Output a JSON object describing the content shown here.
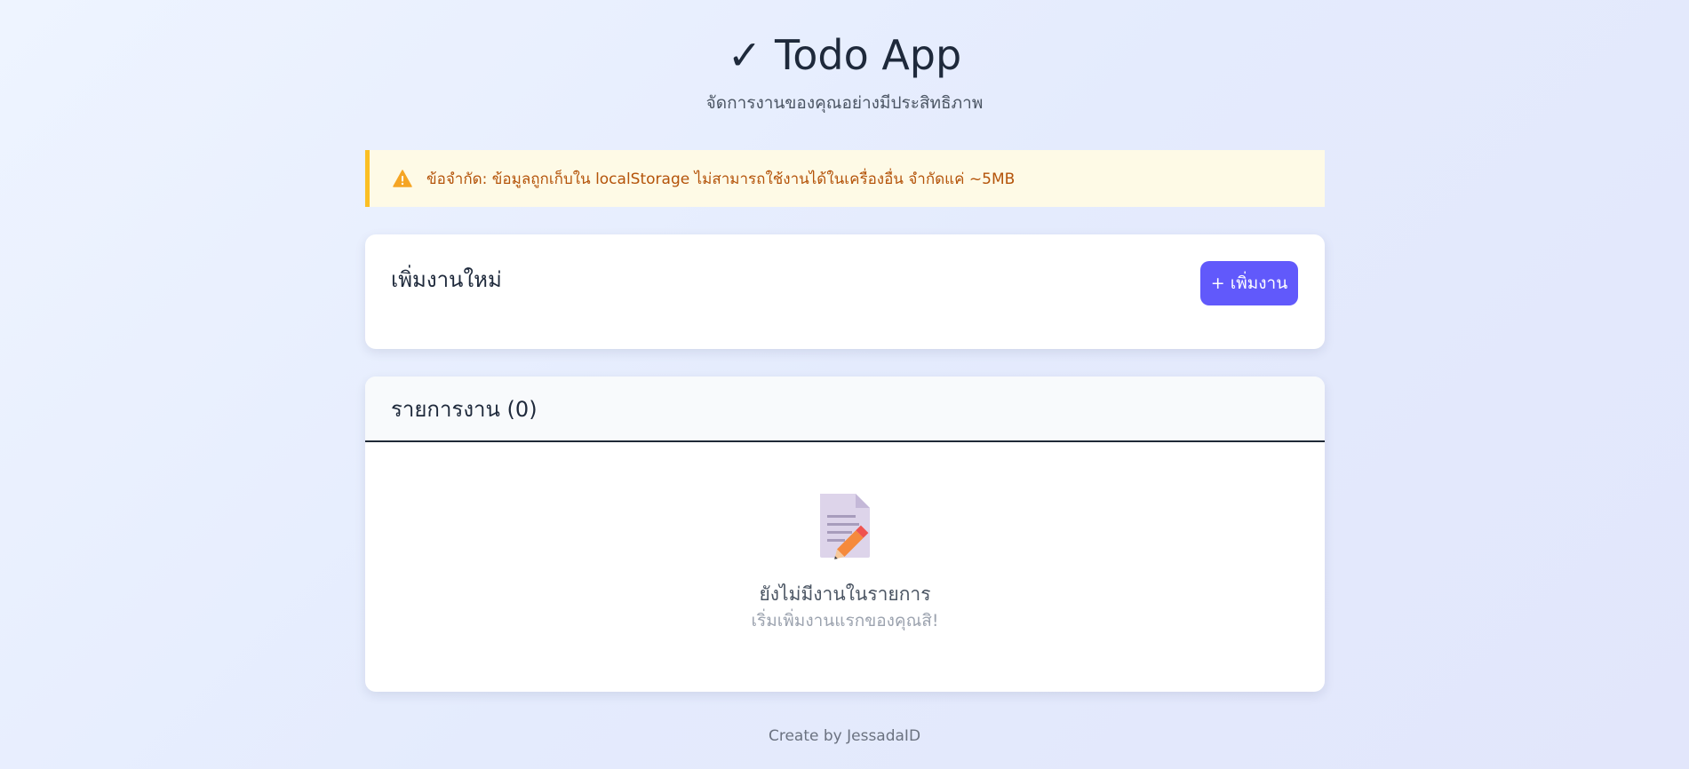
{
  "header": {
    "title": "✓ Todo App",
    "subtitle": "จัดการงานของคุณอย่างมีประสิทธิภาพ"
  },
  "warning": {
    "icon": "warning-icon",
    "text": "ข้อจำกัด: ข้อมูลถูกเก็บใน localStorage ไม่สามารถใช้งานได้ในเครื่องอื่น จำกัดแค่ ~5MB"
  },
  "add_task": {
    "title": "เพิ่มงานใหม่",
    "button_label": "+ เพิ่มงาน"
  },
  "task_list": {
    "title": "รายการงาน (0)",
    "empty_icon": "memo-icon",
    "empty_title": "ยังไม่มีงานในรายการ",
    "empty_subtitle": "เริ่มเพิ่มงานแรกของคุณสิ!"
  },
  "footer": {
    "text": "Create by JessadaID"
  },
  "colors": {
    "accent": "#6159fb",
    "warning_border": "#fbbf24",
    "warning_bg": "#fefae6",
    "warning_text": "#b45309"
  }
}
